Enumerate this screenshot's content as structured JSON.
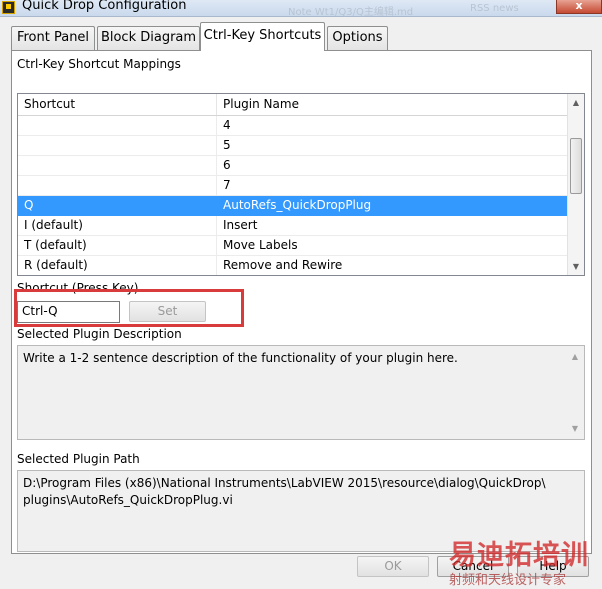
{
  "window": {
    "title": "Quick Drop Configuration",
    "ghost_text_1": "Note Wt1/Q3/Q主编辑.md",
    "ghost_text_2": "RSS news",
    "minimize_glyph": "–",
    "maximize_glyph": "□",
    "close_glyph": "x"
  },
  "tabs": [
    {
      "label": "Front Panel"
    },
    {
      "label": "Block Diagram"
    },
    {
      "label": "Ctrl-Key Shortcuts"
    },
    {
      "label": "Options"
    }
  ],
  "mappings": {
    "section_label": "Ctrl-Key Shortcut Mappings",
    "columns": [
      "Shortcut",
      "Plugin Name"
    ],
    "rows": [
      {
        "shortcut": "",
        "plugin": "4"
      },
      {
        "shortcut": "",
        "plugin": "5"
      },
      {
        "shortcut": "",
        "plugin": "6"
      },
      {
        "shortcut": "",
        "plugin": "7"
      },
      {
        "shortcut": "Q",
        "plugin": "AutoRefs_QuickDropPlug"
      },
      {
        "shortcut": "I (default)",
        "plugin": "Insert"
      },
      {
        "shortcut": "T (default)",
        "plugin": "Move Labels"
      },
      {
        "shortcut": "R (default)",
        "plugin": "Remove and Rewire"
      }
    ],
    "selected_row": 4,
    "scroll_up_glyph": "▲",
    "scroll_down_glyph": "▼"
  },
  "shortcut": {
    "label": "Shortcut (Press Key)",
    "value": "Ctrl-Q",
    "set_label": "Set"
  },
  "description": {
    "label": "Selected Plugin Description",
    "text": "Write a 1-2 sentence description of the functionality of your plugin here."
  },
  "path": {
    "label": "Selected Plugin Path",
    "text": "D:\\Program Files (x86)\\National Instruments\\LabVIEW 2015\\resource\\dialog\\QuickDrop\\ plugins\\AutoRefs_QuickDropPlug.vi"
  },
  "buttons": {
    "ok": "OK",
    "cancel": "Cancel",
    "help": "Help"
  },
  "watermark": {
    "main": "易迪拓培训",
    "sub": "射频和天线设计专家"
  },
  "colors": {
    "selection": "#3399ff",
    "highlight": "#d83b3b",
    "panel": "#ffffff",
    "dialog": "#f0f0f0"
  }
}
